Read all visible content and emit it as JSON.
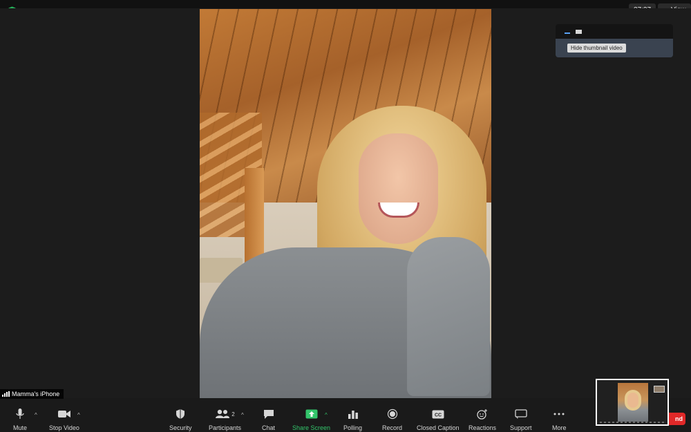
{
  "meeting": {
    "timer": "27:27",
    "view_label": "View",
    "participant_name": "Mamma's iPhone",
    "encryption_icon": "shield-check-icon",
    "accent_green": "#33c56b",
    "end_red": "#e02828"
  },
  "thumbnail_panel": {
    "tooltip": "Hide thumbnail video"
  },
  "toolbar": {
    "mute": {
      "label": "Mute",
      "icon": "microphone-icon"
    },
    "stop_video": {
      "label": "Stop Video",
      "icon": "video-camera-icon"
    },
    "security": {
      "label": "Security",
      "icon": "shield-icon"
    },
    "participants": {
      "label": "Participants",
      "count": "2",
      "icon": "people-icon"
    },
    "chat": {
      "label": "Chat",
      "icon": "chat-bubble-icon"
    },
    "share_screen": {
      "label": "Share Screen",
      "icon": "share-arrow-icon"
    },
    "polling": {
      "label": "Polling",
      "icon": "bar-chart-icon"
    },
    "record": {
      "label": "Record",
      "icon": "record-dot-icon"
    },
    "closed_caption": {
      "label": "Closed Caption",
      "icon": "cc-icon"
    },
    "reactions": {
      "label": "Reactions",
      "icon": "smiley-plus-icon"
    },
    "support": {
      "label": "Support",
      "icon": "screen-cast-icon"
    },
    "more": {
      "label": "More",
      "icon": "dots-icon"
    },
    "end_label": "nd"
  }
}
